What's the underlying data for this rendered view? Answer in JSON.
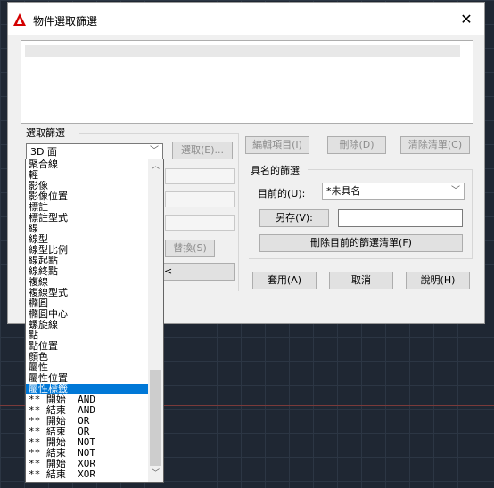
{
  "title": "物件選取篩選",
  "close_label": "✕",
  "selection_filter": {
    "label": "選取篩選",
    "current": "3D 面",
    "select_button": "選取(E)...",
    "replace_button": "替換(S)",
    "arrow_button": "<"
  },
  "top_buttons": {
    "edit": "編輯項目(I)",
    "delete": "刪除(D)",
    "clear": "清除清單(C)"
  },
  "named_filters": {
    "label": "具名的篩選",
    "current_label": "目前的(U):",
    "current_value": "*未具名",
    "save_as": "另存(V):",
    "delete_current": "刪除目前的篩選清單(F)"
  },
  "bottom_buttons": {
    "apply": "套用(A)",
    "cancel": "取消",
    "help": "說明(H)"
  },
  "dropdown_items": [
    "聚合線",
    "輕",
    "影像",
    "影像位置",
    "標註",
    "標註型式",
    "線",
    "線型",
    "線型比例",
    "線起點",
    "線終點",
    "複線",
    "複線型式",
    "橢圓",
    "橢圓中心",
    "螺旋線",
    "點",
    "點位置",
    "顏色",
    "屬性",
    "屬性位置",
    "屬性標籤",
    "** 開始  AND",
    "** 結束  AND",
    "** 開始  OR",
    "** 結束  OR",
    "** 開始  NOT",
    "** 結束  NOT",
    "** 開始  XOR",
    "** 結束  XOR"
  ],
  "selected_index": 21,
  "colors": {
    "selection": "#0078d7",
    "dialog": "#f0f0f0",
    "background": "#1f2733"
  }
}
